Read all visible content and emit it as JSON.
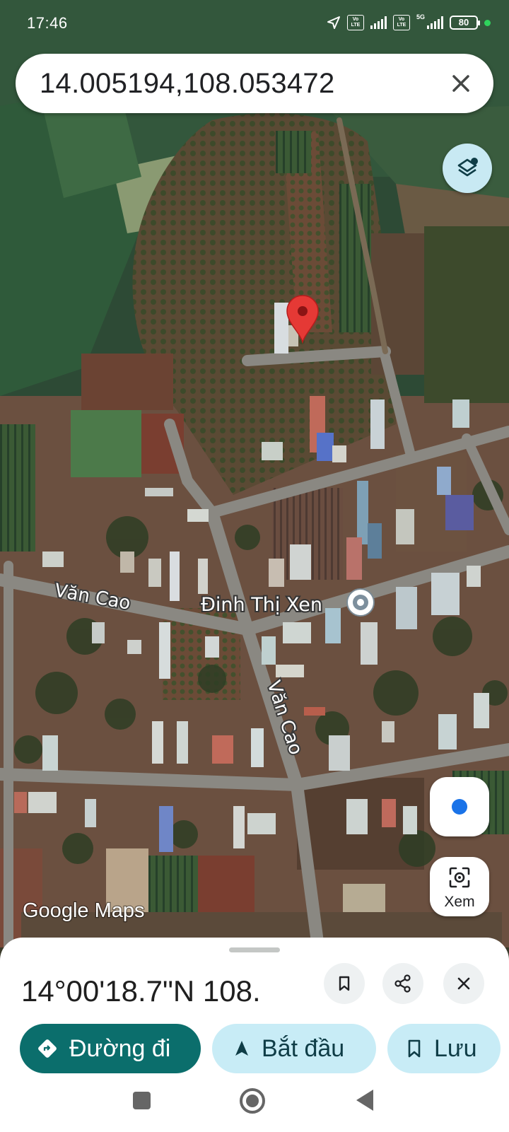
{
  "status_bar": {
    "time": "17:46",
    "volte_1": "Vo LTE",
    "volte_2": "Vo LTE",
    "network": "5G",
    "battery": "80"
  },
  "search": {
    "value": "14.005194,108.053472",
    "clear_icon": "close-icon"
  },
  "map": {
    "road_labels": [
      "Văn Cao",
      "Văn Cao"
    ],
    "place_label": "Đinh Thị Xen",
    "logo": "Google Maps",
    "pin_color": "#e53935"
  },
  "buttons": {
    "layers_icon": "layers-icon",
    "location_icon": "my-location-icon",
    "lens_label": "Xem"
  },
  "sheet": {
    "title": "14°00'18.7\"N 108.",
    "actions": {
      "directions": "Đường đi",
      "start": "Bắt đầu",
      "save": "Lưu"
    }
  },
  "colors": {
    "directions_bg": "#0b6e6c",
    "chip_bg": "#c8ecf6",
    "accent_blue": "#1a73e8"
  }
}
